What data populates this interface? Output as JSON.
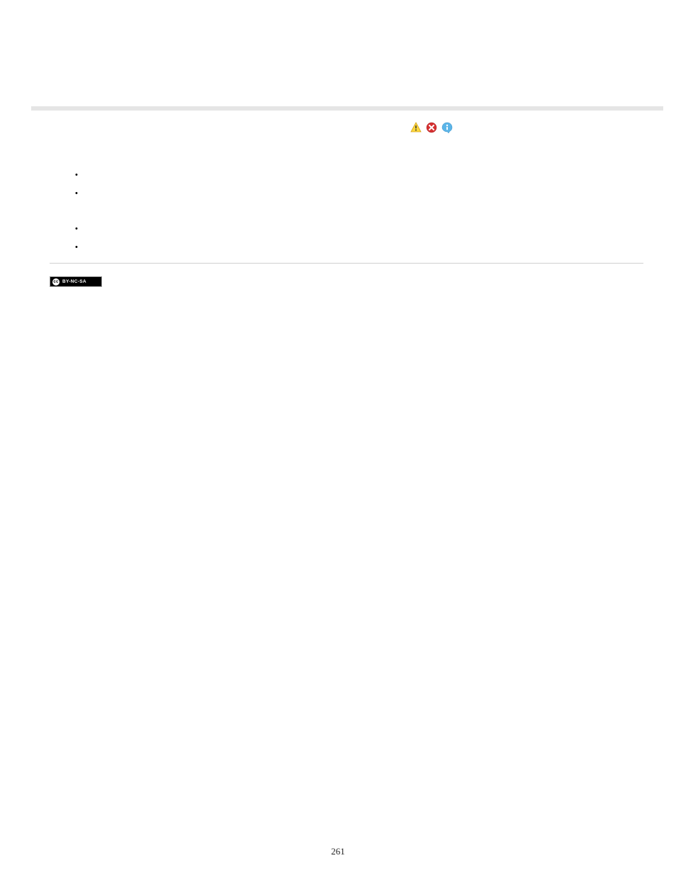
{
  "page_number": "261",
  "cc_license": {
    "circle": "cc",
    "text": "BY-NC-SA"
  },
  "bullets_group_1": [
    "",
    ""
  ],
  "bullets_group_2": [
    "",
    ""
  ]
}
